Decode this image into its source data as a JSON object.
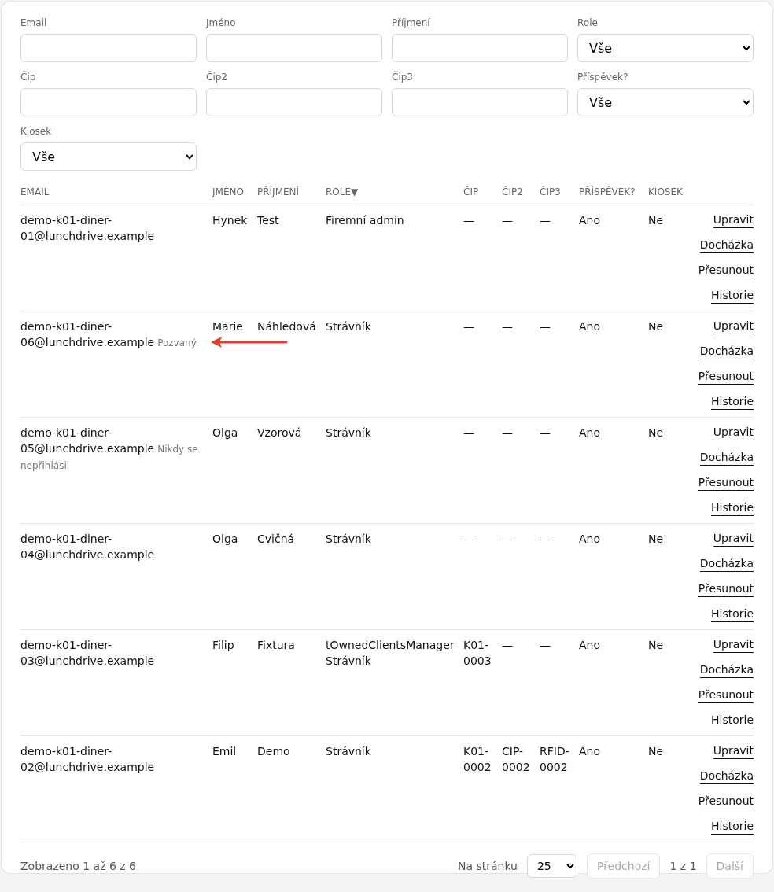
{
  "filters": [
    {
      "label": "Email",
      "kind": "input"
    },
    {
      "label": "Jméno",
      "kind": "input"
    },
    {
      "label": "Příjmení",
      "kind": "input"
    },
    {
      "label": "Role",
      "kind": "select",
      "value": "Vše"
    },
    {
      "label": "Čip",
      "kind": "input"
    },
    {
      "label": "Čip2",
      "kind": "input"
    },
    {
      "label": "Čip3",
      "kind": "input"
    },
    {
      "label": "Příspěvek?",
      "kind": "select",
      "value": "Vše"
    },
    {
      "label": "Kiosek",
      "kind": "select",
      "value": "Vše"
    }
  ],
  "table": {
    "columns": [
      {
        "label": "EMAIL"
      },
      {
        "label": "JMÉNO"
      },
      {
        "label": "PŘÍJMENÍ"
      },
      {
        "label": "ROLE",
        "sort": "▼"
      },
      {
        "label": "ČIP"
      },
      {
        "label": "ČIP2"
      },
      {
        "label": "ČIP3"
      },
      {
        "label": "PŘÍSPĚVEK?"
      },
      {
        "label": "KIOSEK"
      }
    ],
    "rows": [
      {
        "email": "demo-k01-diner-01@lunchdrive.example",
        "jmeno": "Hynek",
        "prijmeni": "Test",
        "role": [
          "Firemní admin"
        ],
        "cip": "—",
        "cip2": "—",
        "cip3": "—",
        "prispevek": "Ano",
        "kiosek": "Ne",
        "actions": [
          "Upravit",
          "Docházka",
          "Přesunout",
          "Historie"
        ]
      },
      {
        "email": "demo-k01-diner-06@lunchdrive.example",
        "status": "Pozvaný",
        "arrow": true,
        "jmeno": "Marie",
        "prijmeni": "Náhledová",
        "role": [
          "Strávník"
        ],
        "cip": "—",
        "cip2": "—",
        "cip3": "—",
        "prispevek": "Ano",
        "kiosek": "Ne",
        "actions": [
          "Upravit",
          "Docházka",
          "Přesunout",
          "Historie"
        ]
      },
      {
        "email": "demo-k01-diner-05@lunchdrive.example",
        "status": "Nikdy se nepřihlásil",
        "jmeno": "Olga",
        "prijmeni": "Vzorová",
        "role": [
          "Strávník"
        ],
        "cip": "—",
        "cip2": "—",
        "cip3": "—",
        "prispevek": "Ano",
        "kiosek": "Ne",
        "actions": [
          "Upravit",
          "Docházka",
          "Přesunout",
          "Historie"
        ]
      },
      {
        "email": "demo-k01-diner-04@lunchdrive.example",
        "jmeno": "Olga",
        "prijmeni": "Cvičná",
        "role": [
          "Strávník"
        ],
        "cip": "—",
        "cip2": "—",
        "cip3": "—",
        "prispevek": "Ano",
        "kiosek": "Ne",
        "actions": [
          "Upravit",
          "Docházka",
          "Přesunout",
          "Historie"
        ]
      },
      {
        "email": "demo-k01-diner-03@lunchdrive.example",
        "jmeno": "Filip",
        "prijmeni": "Fixtura",
        "role": [
          "tOwnedClientsManager",
          "Strávník"
        ],
        "cip": "K01-0003",
        "cip2": "—",
        "cip3": "—",
        "prispevek": "Ano",
        "kiosek": "Ne",
        "actions": [
          "Upravit",
          "Docházka",
          "Přesunout",
          "Historie"
        ]
      },
      {
        "email": "demo-k01-diner-02@lunchdrive.example",
        "jmeno": "Emil",
        "prijmeni": "Demo",
        "role": [
          "Strávník"
        ],
        "cip": "K01-0002",
        "cip2": "CIP-0002",
        "cip3": "RFID-0002",
        "prispevek": "Ano",
        "kiosek": "Ne",
        "actions": [
          "Upravit",
          "Docházka",
          "Přesunout",
          "Historie"
        ]
      }
    ]
  },
  "footer": {
    "summary": "Zobrazeno 1 až 6 z 6",
    "per_page_label": "Na stránku",
    "per_page": "25",
    "prev": {
      "label": "Předchozí",
      "disabled": true
    },
    "page": "1 z 1",
    "next": {
      "label": "Další",
      "disabled": true
    }
  }
}
